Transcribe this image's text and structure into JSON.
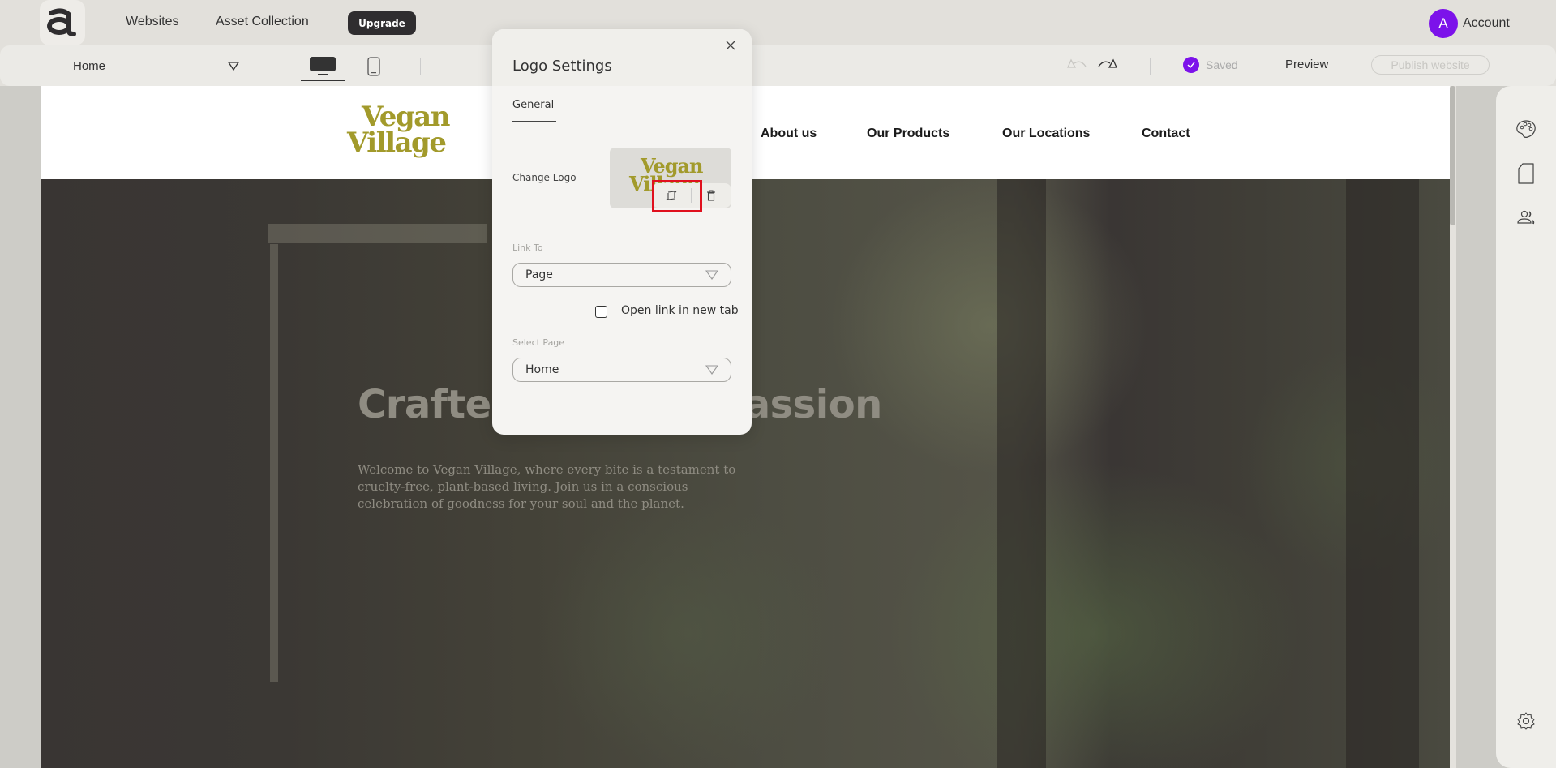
{
  "topbar": {
    "logo_icon": "app-logo-a",
    "nav": [
      "Websites",
      "Asset Collection"
    ],
    "upgrade_label": "Upgrade",
    "account": {
      "avatar_initial": "A",
      "label": "Account",
      "avatar_color": "#7c12ea"
    }
  },
  "toolbar": {
    "page_select": "Home",
    "devices": [
      {
        "name": "desktop",
        "active": true
      },
      {
        "name": "mobile",
        "active": false
      }
    ],
    "undo_icon": "undo-icon",
    "redo_icon": "redo-icon",
    "saved_label": "Saved",
    "preview_label": "Preview",
    "publish_label": "Publish website"
  },
  "site": {
    "logo": {
      "line1": "Vegan",
      "line2": "Village",
      "color": "#a29a2b"
    },
    "nav": [
      "About us",
      "Our Products",
      "Our Locations",
      "Contact"
    ],
    "hero": {
      "title_left": "Crafter",
      "title_right": "passion",
      "text": "Welcome to Vegan Village, where every bite is a testament to cruelty-free, plant-based living. Join us in a conscious celebration of goodness for your soul and the planet."
    }
  },
  "right_rail": {
    "icons": [
      "palette-icon",
      "page-icon",
      "users-icon",
      "settings-icon"
    ]
  },
  "modal": {
    "title": "Logo Settings",
    "tab": "General",
    "change_logo_label": "Change Logo",
    "logo_preview": {
      "line1": "Vegan",
      "line2": "Village"
    },
    "actions": [
      "replace-icon",
      "trash-icon"
    ],
    "link_to_label": "Link To",
    "link_to_value": "Page",
    "open_new_tab_label": "Open link in new tab",
    "open_new_tab_checked": false,
    "select_page_label": "Select Page",
    "select_page_value": "Home",
    "highlight_color": "#e0101e"
  }
}
